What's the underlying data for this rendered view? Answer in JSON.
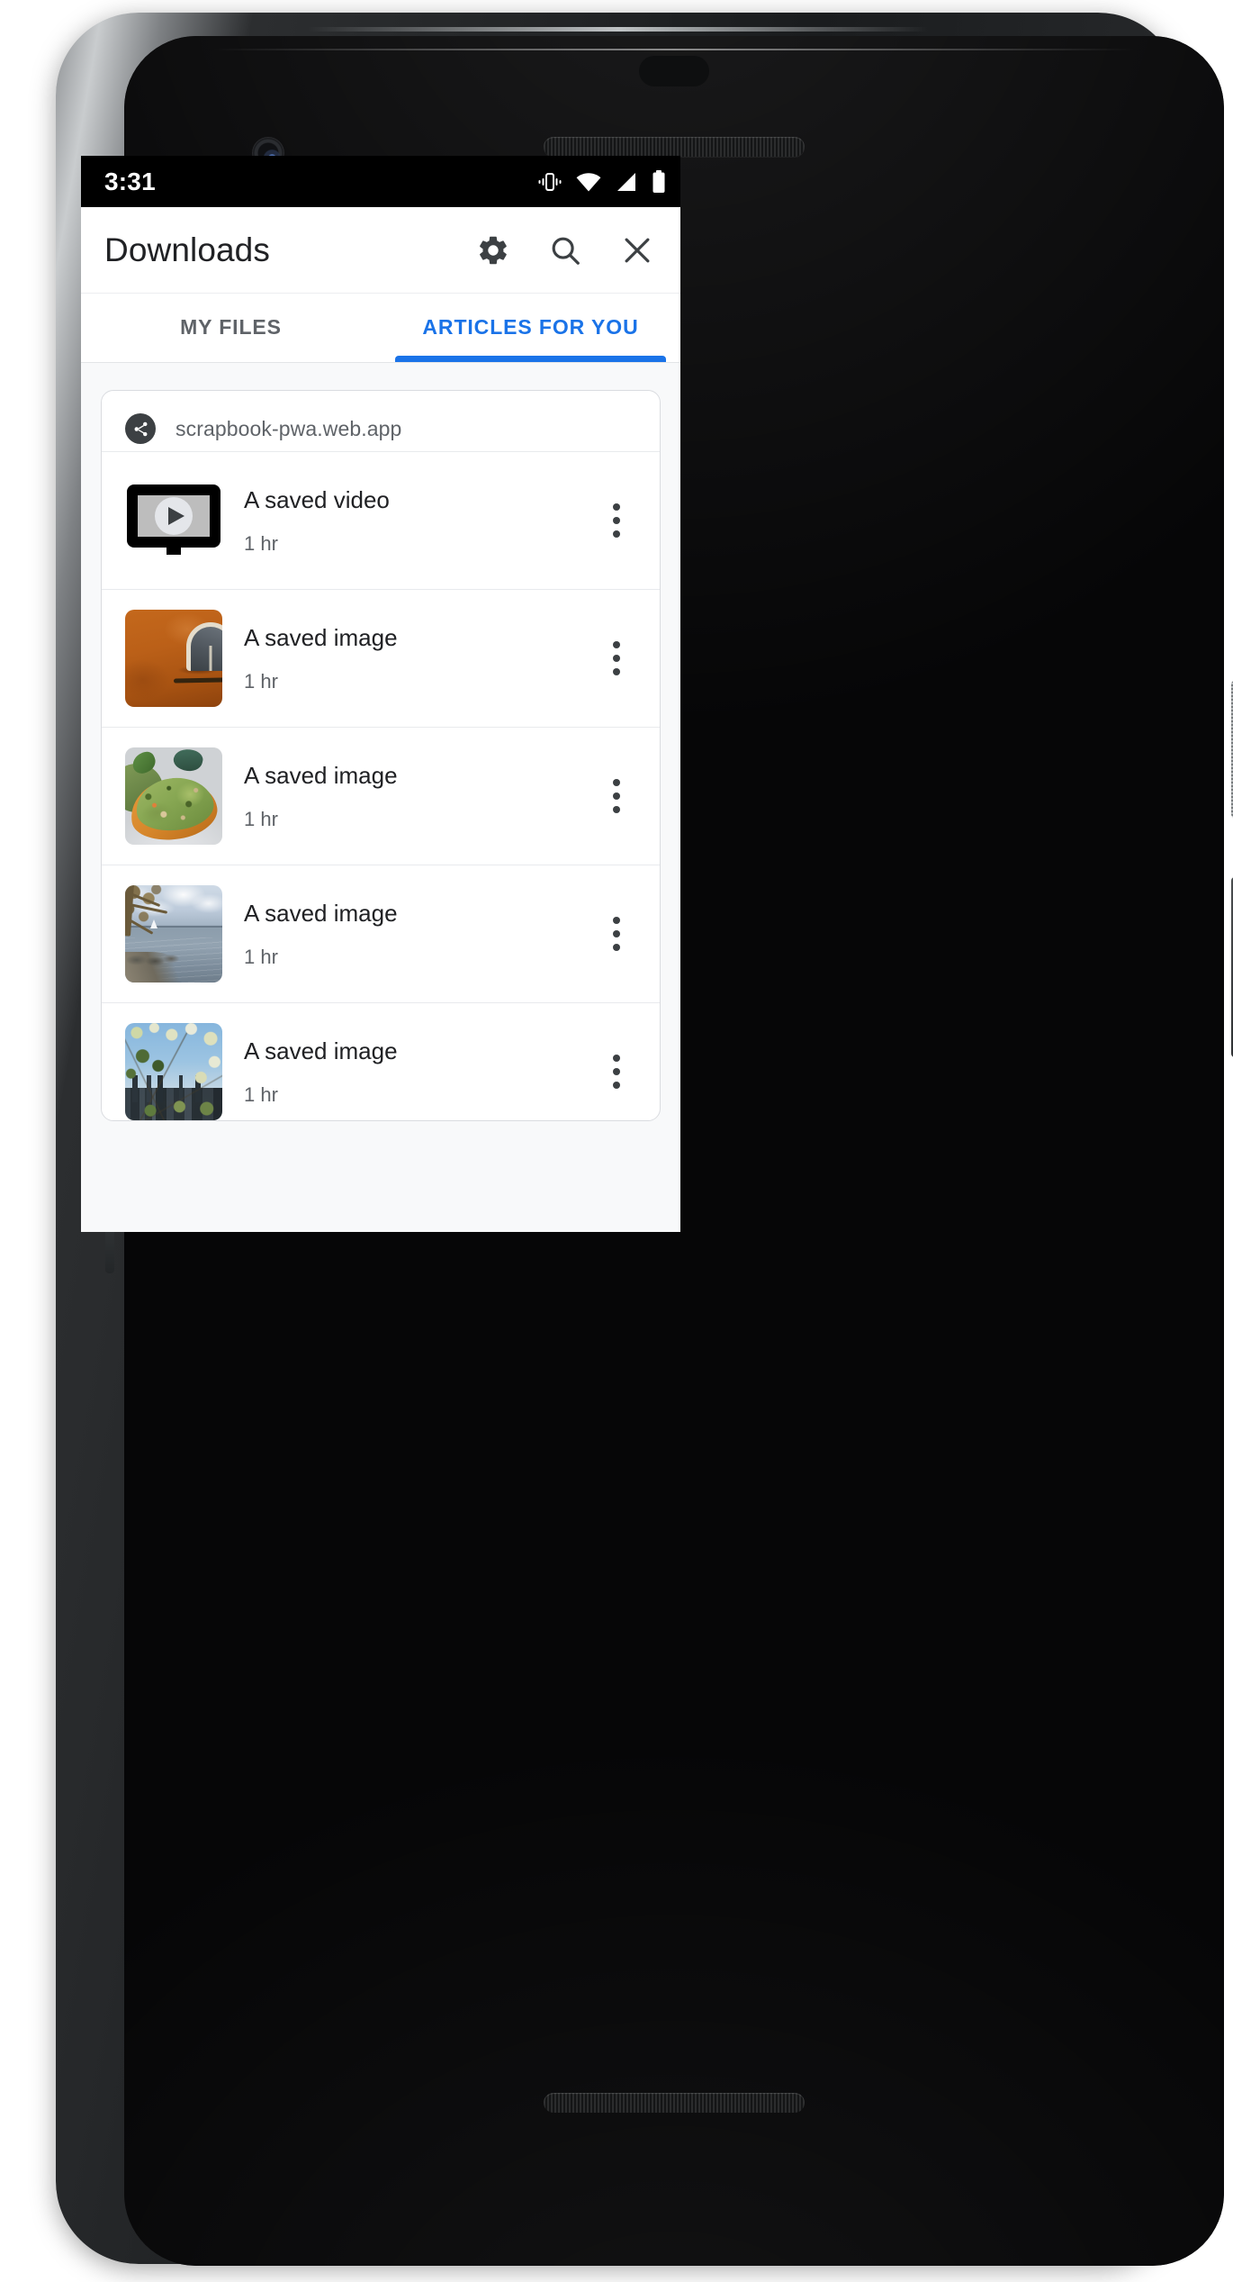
{
  "status_bar": {
    "time": "3:31",
    "icons": [
      "vibrate-icon",
      "wifi-icon",
      "cellular-signal-icon",
      "battery-icon"
    ]
  },
  "app_bar": {
    "title": "Downloads",
    "actions": [
      {
        "name": "settings-button",
        "icon": "gear-icon"
      },
      {
        "name": "search-button",
        "icon": "search-icon"
      },
      {
        "name": "close-button",
        "icon": "close-icon"
      }
    ]
  },
  "tabs": [
    {
      "label": "MY FILES",
      "active": false
    },
    {
      "label": "ARTICLES FOR YOU",
      "active": true
    }
  ],
  "card": {
    "site_icon": "share-icon",
    "site_name": "scrapbook-pwa.web.app",
    "items": [
      {
        "title": "A saved video",
        "subtitle": "1 hr",
        "thumbnail": "video-placeholder-icon",
        "menu": "more-options-icon"
      },
      {
        "title": "A saved image",
        "subtitle": "1 hr",
        "thumbnail": "terracotta-wall-photo",
        "menu": "more-options-icon"
      },
      {
        "title": "A saved image",
        "subtitle": "1 hr",
        "thumbnail": "avocado-toast-photo",
        "menu": "more-options-icon"
      },
      {
        "title": "A saved image",
        "subtitle": "1 hr",
        "thumbnail": "lake-shore-photo",
        "menu": "more-options-icon"
      },
      {
        "title": "A saved image",
        "subtitle": "1 hr",
        "thumbnail": "city-blossoms-photo",
        "menu": "more-options-icon"
      }
    ]
  },
  "colors": {
    "accent": "#1a73e8",
    "text_primary": "#202124",
    "text_secondary": "#5f6368",
    "surface": "#ffffff",
    "background": "#f8f9fa",
    "divider": "#e8eaed",
    "status_bar": "#000000"
  }
}
